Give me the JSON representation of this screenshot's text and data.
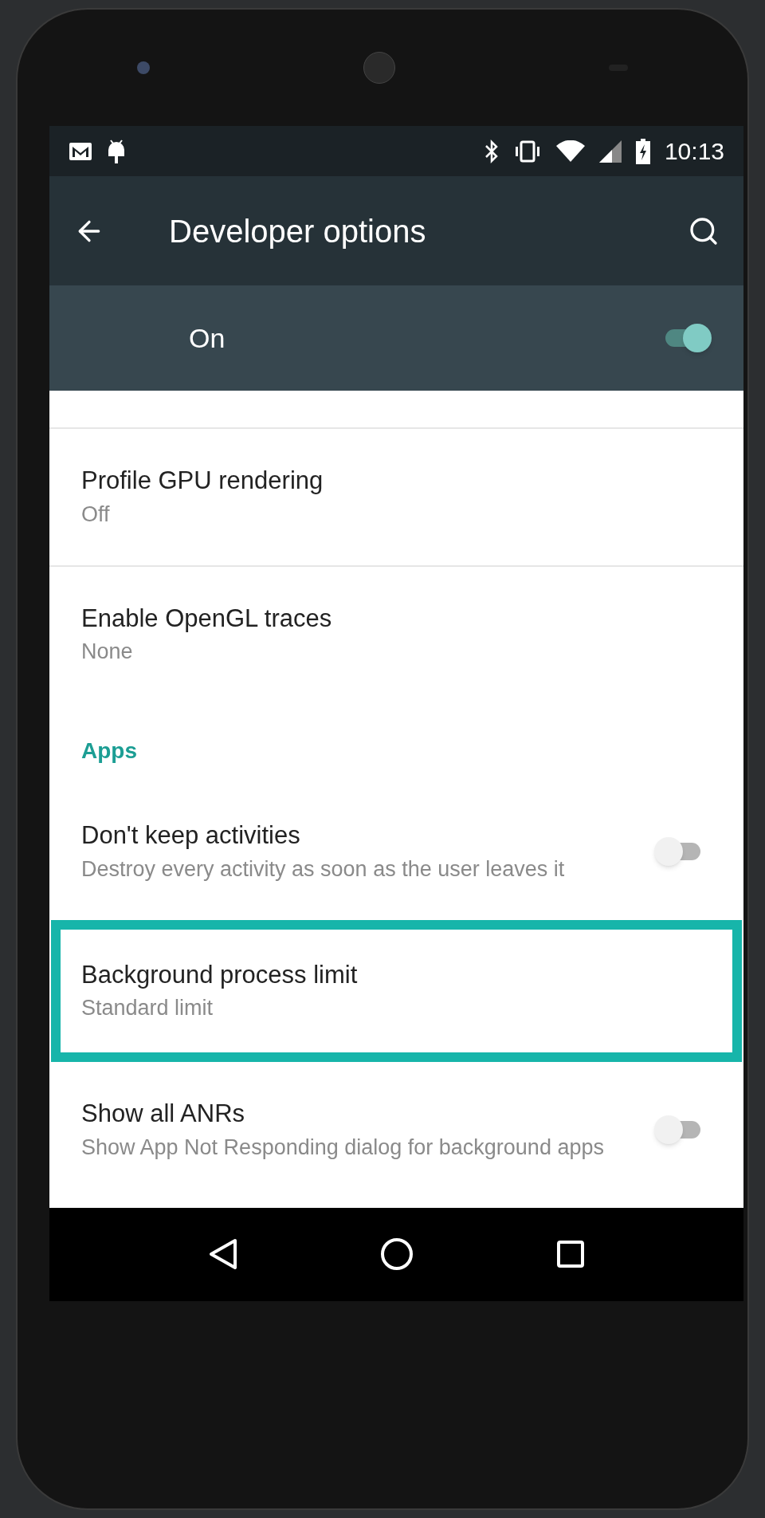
{
  "status_bar": {
    "time": "10:13"
  },
  "toolbar": {
    "title": "Developer options"
  },
  "master_switch": {
    "label": "On",
    "on": true
  },
  "settings": [
    {
      "kind": "value",
      "title": "Profile GPU rendering",
      "summary": "Off",
      "highlighted": false
    },
    {
      "kind": "value",
      "title": "Enable OpenGL traces",
      "summary": "None",
      "highlighted": false
    },
    {
      "kind": "header",
      "title": "Apps"
    },
    {
      "kind": "switch",
      "title": "Don't keep activities",
      "summary": "Destroy every activity as soon as the user leaves it",
      "on": false,
      "highlighted": false
    },
    {
      "kind": "value",
      "title": "Background process limit",
      "summary": "Standard limit",
      "highlighted": true
    },
    {
      "kind": "switch",
      "title": "Show all ANRs",
      "summary": "Show App Not Responding dialog for background apps",
      "on": false,
      "highlighted": false
    }
  ]
}
